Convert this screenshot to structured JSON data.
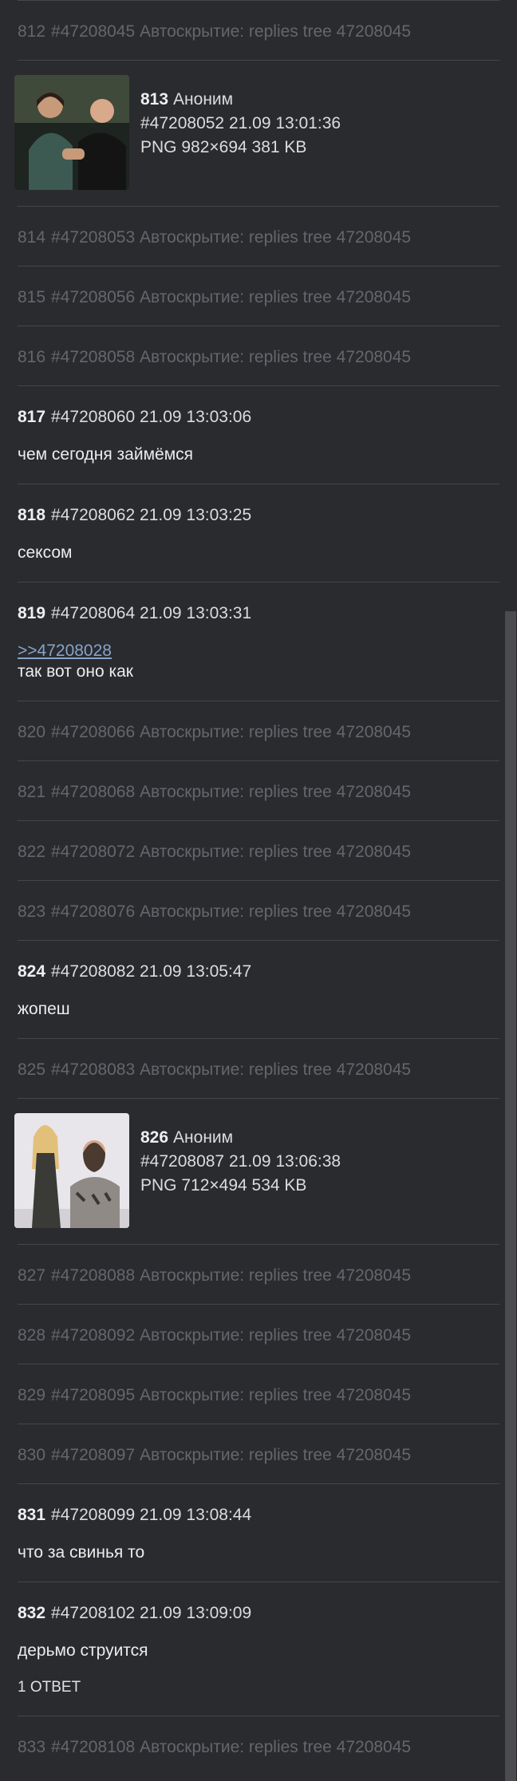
{
  "posts": [
    {
      "kind": "hidden",
      "num": "812",
      "id": "#47208045",
      "note": "Автоскрытие: replies tree 47208045"
    },
    {
      "kind": "image",
      "num": "813",
      "name": "Аноним",
      "id": "#47208052",
      "date": "21.09 13:01:36",
      "file": "PNG 982×694 381 KB",
      "thumb": "thumbnail-men-icon"
    },
    {
      "kind": "hidden",
      "num": "814",
      "id": "#47208053",
      "note": "Автоскрытие: replies tree 47208045"
    },
    {
      "kind": "hidden",
      "num": "815",
      "id": "#47208056",
      "note": "Автоскрытие: replies tree 47208045"
    },
    {
      "kind": "hidden",
      "num": "816",
      "id": "#47208058",
      "note": "Автоскрытие: replies tree 47208045"
    },
    {
      "kind": "text",
      "num": "817",
      "id": "#47208060",
      "date": "21.09 13:03:06",
      "body": "чем сегодня займёмся"
    },
    {
      "kind": "text",
      "num": "818",
      "id": "#47208062",
      "date": "21.09 13:03:25",
      "body": "сексом"
    },
    {
      "kind": "text",
      "num": "819",
      "id": "#47208064",
      "date": "21.09 13:03:31",
      "link": ">>47208028",
      "body": "так вот оно как"
    },
    {
      "kind": "hidden",
      "num": "820",
      "id": "#47208066",
      "note": "Автоскрытие: replies tree 47208045"
    },
    {
      "kind": "hidden",
      "num": "821",
      "id": "#47208068",
      "note": "Автоскрытие: replies tree 47208045"
    },
    {
      "kind": "hidden",
      "num": "822",
      "id": "#47208072",
      "note": "Автоскрытие: replies tree 47208045"
    },
    {
      "kind": "hidden",
      "num": "823",
      "id": "#47208076",
      "note": "Автоскрытие: replies tree 47208045"
    },
    {
      "kind": "text",
      "num": "824",
      "id": "#47208082",
      "date": "21.09 13:05:47",
      "body": "жопеш"
    },
    {
      "kind": "hidden",
      "num": "825",
      "id": "#47208083",
      "note": "Автоскрытие: replies tree 47208045"
    },
    {
      "kind": "image",
      "num": "826",
      "name": "Аноним",
      "id": "#47208087",
      "date": "21.09 13:06:38",
      "file": "PNG 712×494 534 KB",
      "thumb": "thumbnail-people-icon"
    },
    {
      "kind": "hidden",
      "num": "827",
      "id": "#47208088",
      "note": "Автоскрытие: replies tree 47208045"
    },
    {
      "kind": "hidden",
      "num": "828",
      "id": "#47208092",
      "note": "Автоскрытие: replies tree 47208045"
    },
    {
      "kind": "hidden",
      "num": "829",
      "id": "#47208095",
      "note": "Автоскрытие: replies tree 47208045"
    },
    {
      "kind": "hidden",
      "num": "830",
      "id": "#47208097",
      "note": "Автоскрытие: replies tree 47208045"
    },
    {
      "kind": "text",
      "num": "831",
      "id": "#47208099",
      "date": "21.09 13:08:44",
      "body": "что за свинья то"
    },
    {
      "kind": "text",
      "num": "832",
      "id": "#47208102",
      "date": "21.09 13:09:09",
      "body": "дерьмо струится",
      "answers": "1 ОТВЕТ"
    },
    {
      "kind": "hidden",
      "num": "833",
      "id": "#47208108",
      "note": "Автоскрытие: replies tree 47208045"
    }
  ],
  "colors": {
    "background": "#2a2b2f",
    "divider": "#45464b",
    "hidden_text": "#65666b",
    "link": "#86a3c7"
  }
}
